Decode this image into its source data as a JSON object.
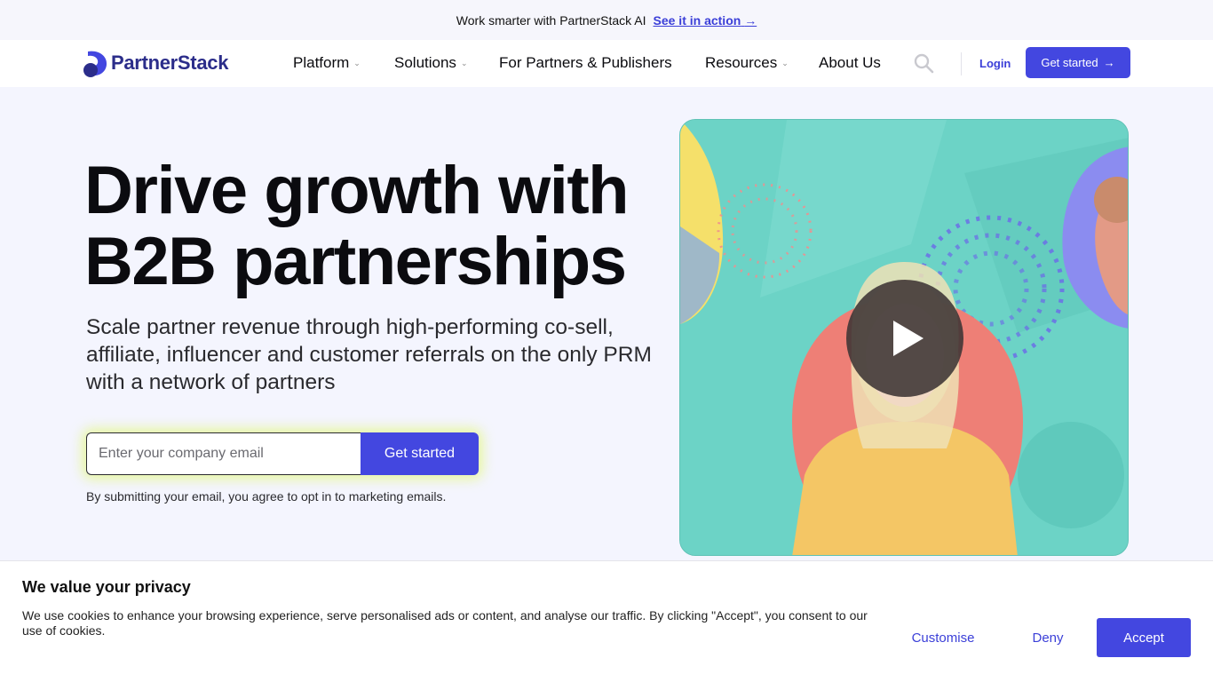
{
  "announcement": {
    "text": "Work smarter with PartnerStack AI",
    "link_label": "See it in action",
    "link_arrow": "→"
  },
  "brand": {
    "name": "PartnerStack",
    "logo_icon": "partnerstack-logo-icon",
    "color": "#2b2d8a"
  },
  "nav": {
    "items": [
      {
        "label": "Platform",
        "has_dropdown": true
      },
      {
        "label": "Solutions",
        "has_dropdown": true
      },
      {
        "label": "For Partners & Publishers",
        "has_dropdown": false
      },
      {
        "label": "Resources",
        "has_dropdown": true
      },
      {
        "label": "About Us",
        "has_dropdown": false
      }
    ],
    "search_icon": "search-icon",
    "login_label": "Login",
    "cta_label": "Get started",
    "cta_arrow": "→"
  },
  "hero": {
    "title_line1": "Drive growth with",
    "title_line2": "B2B partnerships",
    "subtitle": "Scale partner revenue through high-performing co-sell, affiliate, influencer and customer referrals on the only PRM with a network of partners",
    "email_placeholder": "Enter your company email",
    "submit_label": "Get started",
    "disclaimer": "By submitting your email, you agree to opt in to marketing emails.",
    "video_play_icon": "play-icon"
  },
  "cookie_banner": {
    "title": "We value your privacy",
    "text": "We use cookies to enhance your browsing experience, serve personalised ads or content, and analyse our traffic. By clicking \"Accept\", you consent to our use of cookies.",
    "customise_label": "Customise",
    "deny_label": "Deny",
    "accept_label": "Accept"
  },
  "colors": {
    "accent": "#4347e0",
    "link": "#3b3fd8",
    "page_bg": "#f4f5fe",
    "video_bg": "#6cd3c6",
    "form_glow": "#e2f778"
  }
}
